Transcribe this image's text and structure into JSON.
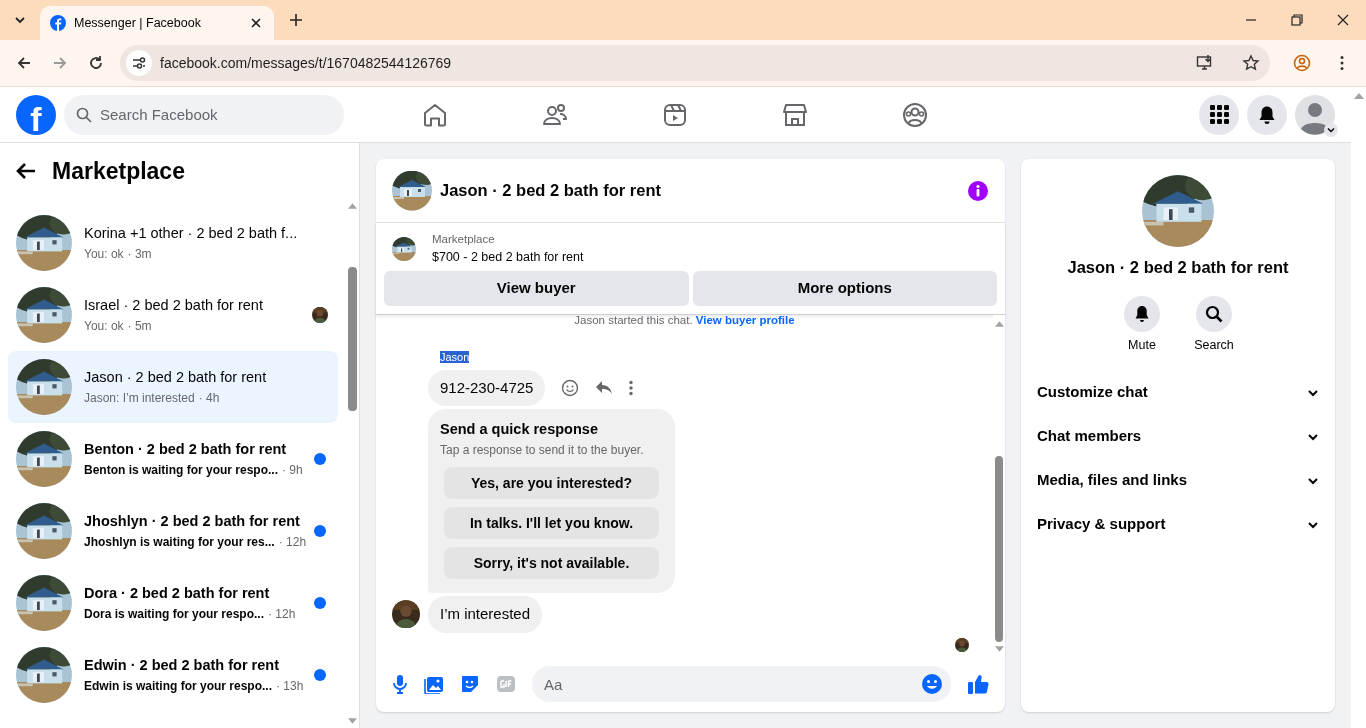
{
  "browser": {
    "tab_title": "Messenger | Facebook",
    "url": "facebook.com/messages/t/1670482544126769"
  },
  "facebook_bar": {
    "logo_text": "f",
    "search_placeholder": "Search Facebook"
  },
  "sidebar": {
    "title": "Marketplace",
    "conversations": [
      {
        "title": "Korina +1 other · 2 bed 2 bath f...",
        "preview": "You: ok",
        "time": "· 3m",
        "unread": false,
        "selected": false,
        "seen_avatar": false
      },
      {
        "title": "Israel · 2 bed 2 bath for rent",
        "preview": "You: ok",
        "time": "· 5m",
        "unread": false,
        "selected": false,
        "seen_avatar": true
      },
      {
        "title": "Jason · 2 bed 2 bath for rent",
        "preview": "Jason: I’m interested",
        "time": "· 4h",
        "unread": false,
        "selected": true,
        "seen_avatar": false
      },
      {
        "title": "Benton · 2 bed 2 bath for rent",
        "preview": "Benton is waiting for your respo...",
        "time": "· 9h",
        "unread": true,
        "selected": false,
        "seen_avatar": false
      },
      {
        "title": "Jhoshlyn · 2 bed 2 bath for rent",
        "preview": "Jhoshlyn is waiting for your res...",
        "time": "· 12h",
        "unread": true,
        "selected": false,
        "seen_avatar": false
      },
      {
        "title": "Dora · 2 bed 2 bath for rent",
        "preview": "Dora is waiting for your respo...",
        "time": "· 12h",
        "unread": true,
        "selected": false,
        "seen_avatar": false
      },
      {
        "title": "Edwin · 2 bed 2 bath for rent",
        "preview": "Edwin is waiting for your respo...",
        "time": "· 13h",
        "unread": true,
        "selected": false,
        "seen_avatar": false
      }
    ]
  },
  "chat": {
    "title": "Jason · 2 bed 2 bath for rent",
    "listing": {
      "source": "Marketplace",
      "label": "$700 - 2 bed 2 bath for rent"
    },
    "actions": [
      "View buyer",
      "More options"
    ],
    "notice": {
      "text": "Jason started this chat.",
      "link": "View buyer profile"
    },
    "messages": [
      {
        "kind": "sender",
        "text": "Jason",
        "highlighted": true
      },
      {
        "kind": "bubble",
        "text": "912-230-4725",
        "show_actions": true,
        "avatar": false
      },
      {
        "kind": "quick_responses",
        "title": "Send a quick response",
        "subtitle": "Tap a response to send it to the buyer.",
        "options": [
          "Yes, are you interested?",
          "In talks. I'll let you know.",
          "Sorry, it's not available."
        ]
      },
      {
        "kind": "bubble",
        "text": "I’m interested",
        "show_actions": false,
        "avatar": true
      }
    ],
    "composer": {
      "placeholder": "Aa"
    }
  },
  "details": {
    "title": "Jason · 2 bed 2 bath for rent",
    "actions": [
      "Mute",
      "Search"
    ],
    "sections": [
      {
        "label": "Customize chat",
        "expanded": false
      },
      {
        "label": "Chat members",
        "expanded": false
      },
      {
        "label": "Media, files and links",
        "expanded": false
      },
      {
        "label": "Privacy & support",
        "expanded": false
      }
    ]
  }
}
